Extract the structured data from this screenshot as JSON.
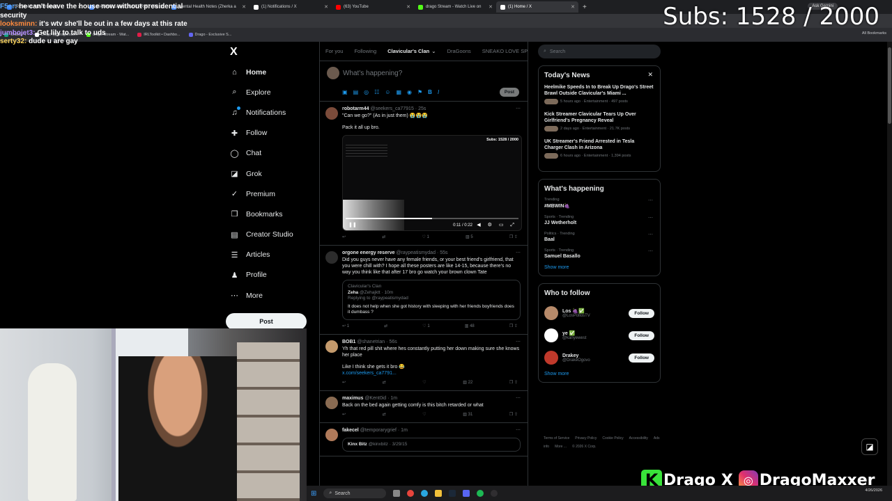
{
  "browser": {
    "tabs": [
      {
        "label": "IRLToolkit • Dashboard",
        "color": "#3b82f6"
      },
      {
        "label": "DATING GAME BLUEPRINT (Be",
        "color": "#4285f4"
      },
      {
        "label": "Mental Health Notes (Zherka a",
        "color": "#4285f4"
      },
      {
        "label": "(1) Notifications / X",
        "color": "#ffffff"
      },
      {
        "label": "(63) YouTube",
        "color": "#ff0000"
      },
      {
        "label": "drago Stream - Watch Live on",
        "color": "#53fc18"
      },
      {
        "label": "(1) Home / X",
        "color": "#ffffff"
      }
    ],
    "new_tab": "+",
    "ask_gemini": "Ask Gemini",
    "bookmarks": [
      {
        "label": "ChatGPT",
        "color": "#10a37f"
      },
      {
        "label": "Drago (@dragomax...",
        "color": "#ffffff"
      },
      {
        "label": "drago Stream - Wat...",
        "color": "#53fc18"
      },
      {
        "label": "IRLToolkit • Dashbo...",
        "color": "#e11d48"
      },
      {
        "label": "Drago - Exclusive S...",
        "color": "#6366f1"
      }
    ],
    "all_bookmarks": "All Bookmarks"
  },
  "stream_overlay": {
    "subs": "Subs: 1528 / 2000",
    "chat": [
      {
        "user": "F5er:",
        "text": "he can't leave the house now without presidential security",
        "color": "#5aa7ff"
      },
      {
        "user": "looksminn:",
        "text": "it's wtv she'll be out in a few days at this rate",
        "color": "#ff8a3d"
      },
      {
        "user": "jumbojet3:",
        "text": "Get lily to talk to uds",
        "color": "#b38cff"
      },
      {
        "user": "serty32:",
        "text": "dude u are gay",
        "color": "#ffd75e"
      }
    ],
    "brand_k": "K",
    "brand_name1": "Drago",
    "brand_x": "X",
    "brand_name2": "DragoMaxxer"
  },
  "x": {
    "logo": "X",
    "nav": [
      {
        "label": "Home",
        "icon": "home-icon",
        "glyph": "⌂"
      },
      {
        "label": "Explore",
        "icon": "search-icon",
        "glyph": "⌕"
      },
      {
        "label": "Notifications",
        "icon": "bell-icon",
        "glyph": "♫"
      },
      {
        "label": "Follow",
        "icon": "follow-icon",
        "glyph": "✚"
      },
      {
        "label": "Chat",
        "icon": "chat-icon",
        "glyph": "◯"
      },
      {
        "label": "Grok",
        "icon": "grok-icon",
        "glyph": "◪"
      },
      {
        "label": "Premium",
        "icon": "premium-icon",
        "glyph": "✓"
      },
      {
        "label": "Bookmarks",
        "icon": "bookmark-icon",
        "glyph": "❒"
      },
      {
        "label": "Creator Studio",
        "icon": "creator-studio-icon",
        "glyph": "▤"
      },
      {
        "label": "Articles",
        "icon": "articles-icon",
        "glyph": "☰"
      },
      {
        "label": "Profile",
        "icon": "profile-icon",
        "glyph": "♟"
      },
      {
        "label": "More",
        "icon": "more-icon",
        "glyph": "⋯"
      }
    ],
    "post_button": "Post",
    "feed_tabs": [
      "For you",
      "Following",
      "Clavicular's Clan",
      "DraGoons",
      "SNEAKO LOVE SP"
    ],
    "composer": {
      "placeholder": "What's happening?",
      "post": "Post"
    },
    "tweets": [
      {
        "name": "robotarm44",
        "handle": "@seekers_ca77915",
        "time": "25s",
        "text": "\"Can we go?\" (As in just them) 😭😭😭",
        "text2": "Pack it all up bro.",
        "media_subs": "Subs: 1528 / 2000",
        "media_time": "0:11 / 0:22",
        "stats": {
          "reply": "",
          "repost": "",
          "like": "1",
          "views": "5"
        }
      },
      {
        "name": "orgone energy reserve",
        "handle": "@raypeatismydad",
        "time": "55s",
        "text": "Did you guys never have any female friends, or your best friend's girlfriend, that you were chill with? I hope all these posters are like 14-15, because there's no way you think like that after 17 bro go watch your brown clown Tate",
        "quote": {
          "community": "Clavicular's Clan",
          "name": "Zeha",
          "handle": "@Zehajktt",
          "time": "10m",
          "replying": "Replying to @raypeatismydad",
          "text": "It does not help when she got history with sleeping with her friends boyfriends does it dumbass ?"
        },
        "stats": {
          "reply": "1",
          "repost": "",
          "like": "1",
          "views": "48"
        }
      },
      {
        "name": "BOB1",
        "handle": "@shanetrian",
        "time": "56s",
        "text": "Yh that red pill shit where hes constantly putting her down making sure she knows her place",
        "text2": "Like I think she gets it bro 😂",
        "link": "x.com/seekers_ca7791...",
        "stats": {
          "reply": "",
          "repost": "",
          "like": "",
          "views": "22"
        }
      },
      {
        "name": "maximus",
        "handle": "@Kent0id",
        "time": "1m",
        "text": "Back on the bed again getting comfy is this bitch retarded or what",
        "stats": {
          "reply": "",
          "repost": "",
          "like": "",
          "views": "31"
        }
      },
      {
        "name": "fakecel",
        "handle": "@temporarygrief",
        "time": "1m",
        "quote": {
          "name": "Kinx Bitz",
          "handle": "@kinxbitz",
          "time": "3/29/15"
        }
      }
    ],
    "search_placeholder": "Search",
    "todays_news": {
      "title": "Today's News",
      "items": [
        {
          "title": "Heelmike Speeds In to Break Up Drago's Street Brawl Outside Clavicular's Miami ...",
          "meta": "5 hours ago · Entertainment · 497 posts"
        },
        {
          "title": "Kick Streamer Clavicular Tears Up Over Girlfriend's Pregnancy Reveal",
          "meta": "2 days ago · Entertainment · 21.7K posts"
        },
        {
          "title": "UK Streamer's Friend Arrested in Tesla Charger Clash in Arizona",
          "meta": "6 hours ago · Entertainment · 1,394 posts"
        }
      ]
    },
    "whats_happening": {
      "title": "What's happening",
      "items": [
        {
          "context": "Trending",
          "name": "#MBWIN🍇"
        },
        {
          "context": "Sports · Trending",
          "name": "JJ Wetherholt"
        },
        {
          "context": "Politics · Trending",
          "name": "Baal"
        },
        {
          "context": "Sports · Trending",
          "name": "Samuel Basallo"
        }
      ],
      "show_more": "Show more"
    },
    "who_to_follow": {
      "title": "Who to follow",
      "items": [
        {
          "name": "Los 🍇✅",
          "handle": "@LosPollosTV",
          "color": "#b78a6a"
        },
        {
          "name": "ye ✅",
          "handle": "@kanyewest",
          "color": "#ffffff"
        },
        {
          "name": "Drakey",
          "handle": "@DrakeOgovo",
          "color": "#c0392b"
        }
      ],
      "follow": "Follow",
      "show_more": "Show more"
    },
    "footer": [
      "Terms of Service",
      "Privacy Policy",
      "Cookie Policy",
      "Accessibility",
      "Ads info",
      "More ...",
      "© 2026 X Corp."
    ]
  },
  "taskbar": {
    "search": "Search",
    "time": "",
    "date": "4/26/2026"
  }
}
